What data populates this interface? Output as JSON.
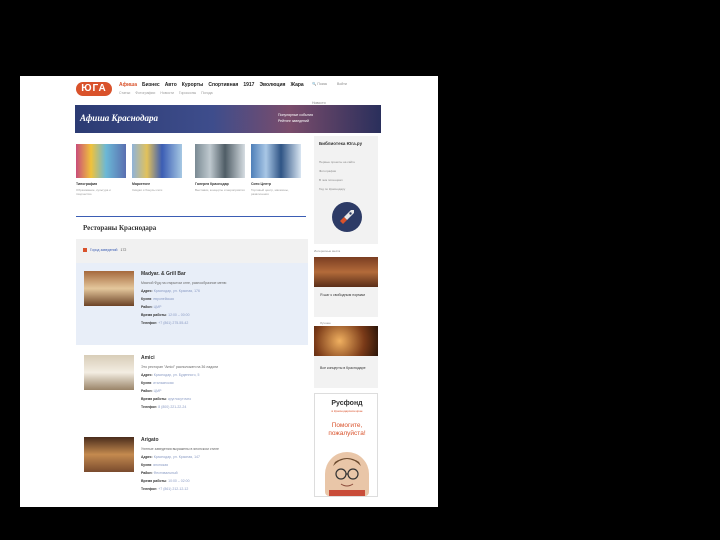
{
  "header": {
    "logo": "ЮГА",
    "nav": [
      "Афиша",
      "Бизнес",
      "Авто",
      "Курорты",
      "Спортивная",
      "1917",
      "Эволюция",
      "Жара"
    ],
    "subnav": [
      "Статьи",
      "Фотографии",
      "Новости",
      "Гороскопы",
      "Погода"
    ],
    "right": [
      "Поиск",
      "Войти"
    ],
    "right2": "Новости"
  },
  "banner": {
    "title": "Афиша Краснодара",
    "links": [
      "Популярные события",
      "Рейтинг заведений"
    ]
  },
  "tiles": [
    {
      "title": "Типография",
      "desc": "Образование, культура и творчество",
      "colors": [
        "#c94d7a",
        "#f0c23b",
        "#6bb8d6",
        "#5a6fb0"
      ]
    },
    {
      "title": "Маркетинг",
      "desc": "Скидки и бонусы сети",
      "colors": [
        "#8fb3d9",
        "#e2c15a",
        "#3b5db4",
        "#a6c8e3"
      ]
    },
    {
      "title": "Галерея Краснодар",
      "desc": "Выставки, концерты и мероприятия",
      "colors": [
        "#7a8a93",
        "#bfc9cf",
        "#4f5d66",
        "#d6dde2"
      ]
    },
    {
      "title": "Сити Центр",
      "desc": "Торговый центр, магазины, развлечения",
      "colors": [
        "#4e7fb8",
        "#a9c7e6",
        "#2f5485",
        "#d9e6f2"
      ]
    }
  ],
  "section_title": "Рестораны Краснодара",
  "filter": {
    "label": "Город заведений",
    "count": "172"
  },
  "restaurants": [
    {
      "name": "Madyar. & Grill Bar",
      "desc": "Мясной Фуд на открытом огне, разнообразное меню",
      "rows": [
        {
          "k": "Адрес",
          "v": "Краснодар, ул. Красная, 176"
        },
        {
          "k": "Кухня",
          "v": "европейская"
        },
        {
          "k": "Район",
          "v": "ЦМР"
        },
        {
          "k": "Время работы",
          "v": "12:00 – 00:00"
        },
        {
          "k": "Телефон",
          "v": "+7 (861) 275-55-42"
        }
      ],
      "img": [
        "#a5683c",
        "#e4c79c",
        "#6b4226"
      ]
    },
    {
      "name": "Amici",
      "desc": "Это ресторан \"Amici\" расположен на 36 ладони",
      "rows": [
        {
          "k": "Адрес",
          "v": "Краснодар, ул. Буденного, 5"
        },
        {
          "k": "Кухня",
          "v": "итальянская"
        },
        {
          "k": "Район",
          "v": "ЦМР"
        },
        {
          "k": "Время работы",
          "v": "круглосуточно"
        },
        {
          "k": "Телефон",
          "v": "8 (800) 221-22-24"
        }
      ],
      "img": [
        "#d8cdb8",
        "#f3ede2",
        "#9a8468"
      ]
    },
    {
      "name": "Arigato",
      "desc": "Уютные заведения выражены в японском стиле",
      "rows": [
        {
          "k": "Адрес",
          "v": "Краснодар, ул. Красная, 147"
        },
        {
          "k": "Кухня",
          "v": "японская"
        },
        {
          "k": "Район",
          "v": "Фестивальный"
        },
        {
          "k": "Время работы",
          "v": "10:00 – 02:00"
        },
        {
          "k": "Телефон",
          "v": "+7 (861) 212-12-12"
        }
      ],
      "img": [
        "#4a2c1c",
        "#c48a4f",
        "#7a4b2e"
      ]
    }
  ],
  "sidebar": {
    "lib_title": "Библиотека Юга.ру",
    "lib_links": [
      "Первые проекты на сайте",
      "Фотографии",
      "В чем потенциал",
      "Гид по Краснодару"
    ],
    "lbl1": "Интересные места",
    "card1": "Я шаг к свободным нормам",
    "lbl2": "Лучшее",
    "card2": "Все концерты в Краснодаре",
    "ad_brand": "Русфонд",
    "ad_sub": "в Краснодарском крае",
    "ad_plea": "Помогите, пожалуйста!"
  }
}
